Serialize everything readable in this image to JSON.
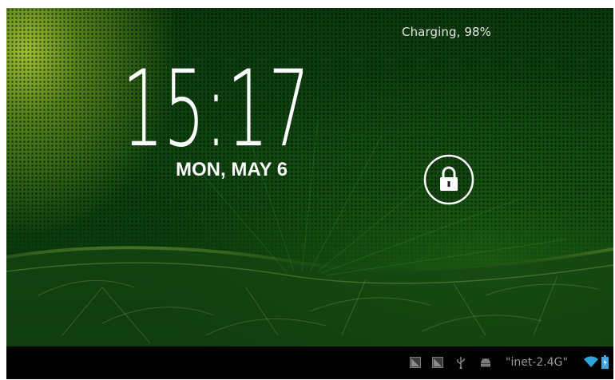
{
  "lockscreen": {
    "charging_status": "Charging, 98%",
    "time": "15:17",
    "date": "MON, MAY 6",
    "lock_icon": "padlock-icon"
  },
  "status_bar": {
    "wifi_name": "\"inet-2.4G\"",
    "icons": [
      "screenshot-notification-icon",
      "screenshot-notification-icon",
      "usb-icon",
      "android-debug-icon",
      "wifi-signal-icon",
      "battery-icon"
    ]
  },
  "colors": {
    "accent_wifi": "#2aa6dc",
    "battery": "#3aa7e0"
  }
}
